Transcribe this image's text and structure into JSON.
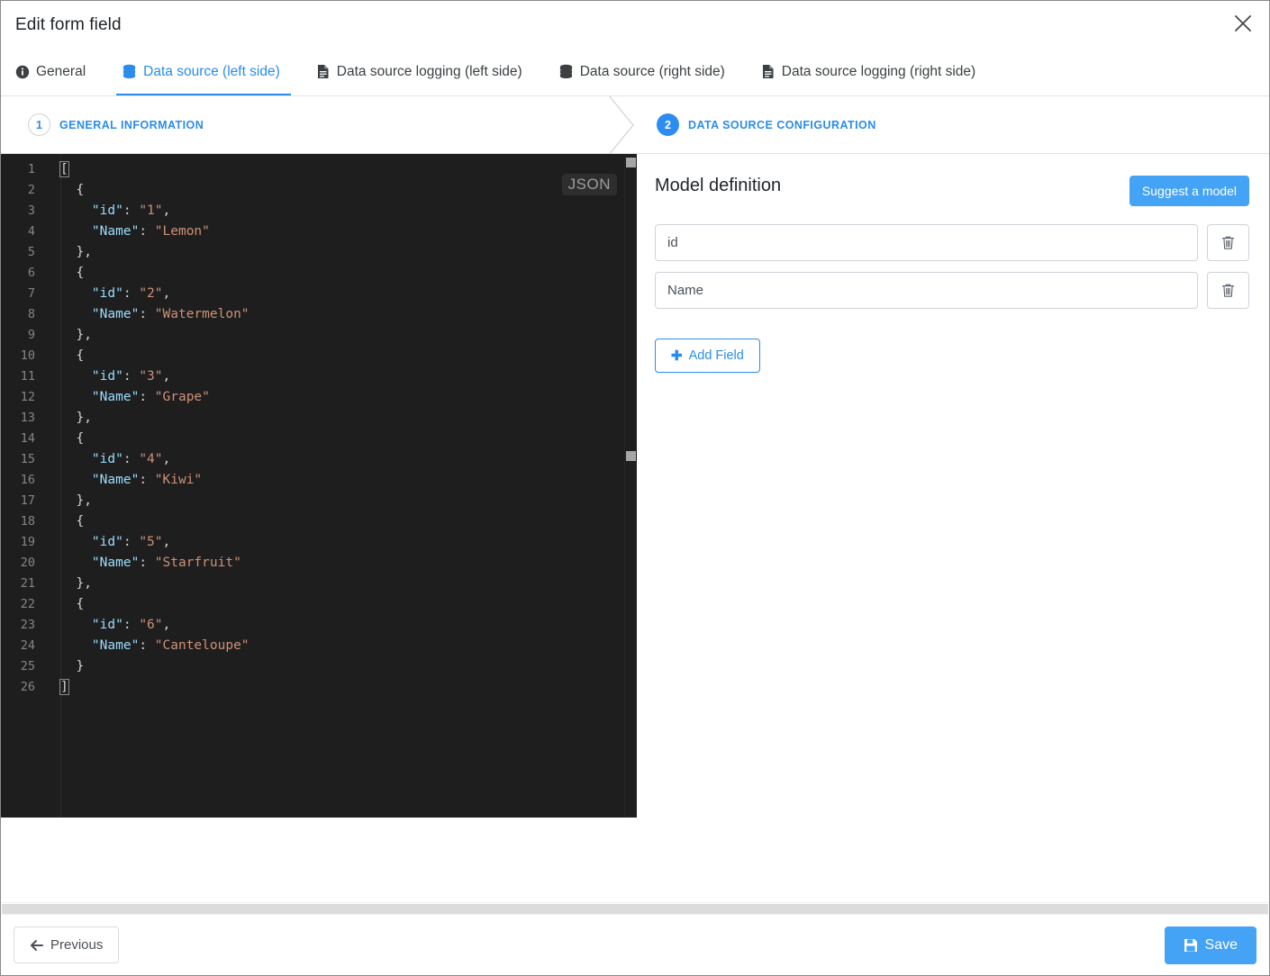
{
  "window": {
    "title": "Edit form field",
    "close_icon": "close-icon"
  },
  "tabs": [
    {
      "label": "General",
      "icon": "info-circle-icon",
      "active": false
    },
    {
      "label": "Data source (left side)",
      "icon": "database-icon",
      "active": true
    },
    {
      "label": "Data source logging (left side)",
      "icon": "file-lines-icon",
      "active": false
    },
    {
      "label": "Data source (right side)",
      "icon": "database-icon",
      "active": false
    },
    {
      "label": "Data source logging (right side)",
      "icon": "file-lines-icon",
      "active": false
    }
  ],
  "steps": [
    {
      "number": "1",
      "label": "GENERAL INFORMATION",
      "state": "done"
    },
    {
      "number": "2",
      "label": "DATA SOURCE CONFIGURATION",
      "state": "current"
    }
  ],
  "editor": {
    "language_badge": "JSON",
    "lines": [
      {
        "n": "1",
        "text": "["
      },
      {
        "n": "2",
        "text": "  {"
      },
      {
        "n": "3",
        "text": "    \"id\": \"1\","
      },
      {
        "n": "4",
        "text": "    \"Name\": \"Lemon\""
      },
      {
        "n": "5",
        "text": "  },"
      },
      {
        "n": "6",
        "text": "  {"
      },
      {
        "n": "7",
        "text": "    \"id\": \"2\","
      },
      {
        "n": "8",
        "text": "    \"Name\": \"Watermelon\""
      },
      {
        "n": "9",
        "text": "  },"
      },
      {
        "n": "10",
        "text": "  {"
      },
      {
        "n": "11",
        "text": "    \"id\": \"3\","
      },
      {
        "n": "12",
        "text": "    \"Name\": \"Grape\""
      },
      {
        "n": "13",
        "text": "  },"
      },
      {
        "n": "14",
        "text": "  {"
      },
      {
        "n": "15",
        "text": "    \"id\": \"4\","
      },
      {
        "n": "16",
        "text": "    \"Name\": \"Kiwi\""
      },
      {
        "n": "17",
        "text": "  },"
      },
      {
        "n": "18",
        "text": "  {"
      },
      {
        "n": "19",
        "text": "    \"id\": \"5\","
      },
      {
        "n": "20",
        "text": "    \"Name\": \"Starfruit\""
      },
      {
        "n": "21",
        "text": "  },"
      },
      {
        "n": "22",
        "text": "  {"
      },
      {
        "n": "23",
        "text": "    \"id\": \"6\","
      },
      {
        "n": "24",
        "text": "    \"Name\": \"Canteloupe\""
      },
      {
        "n": "25",
        "text": "  }"
      },
      {
        "n": "26",
        "text": "]"
      }
    ],
    "records": [
      {
        "id": "1",
        "Name": "Lemon"
      },
      {
        "id": "2",
        "Name": "Watermelon"
      },
      {
        "id": "3",
        "Name": "Grape"
      },
      {
        "id": "4",
        "Name": "Kiwi"
      },
      {
        "id": "5",
        "Name": "Starfruit"
      },
      {
        "id": "6",
        "Name": "Canteloupe"
      }
    ]
  },
  "panel": {
    "title": "Model definition",
    "suggest_label": "Suggest a model",
    "fields": [
      {
        "value": "id",
        "delete_icon": "trash-icon"
      },
      {
        "value": "Name",
        "delete_icon": "trash-icon"
      }
    ],
    "add_field_label": "Add Field",
    "add_field_icon": "plus-icon"
  },
  "footer": {
    "previous_label": "Previous",
    "previous_icon": "arrow-left-icon",
    "save_label": "Save",
    "save_icon": "floppy-disk-icon"
  },
  "colors": {
    "accent": "#2a8ceb",
    "primary_button": "#45a3f5",
    "editor_background": "#1e1e1e",
    "string": "#ce9178",
    "key": "#9cdcfe"
  }
}
